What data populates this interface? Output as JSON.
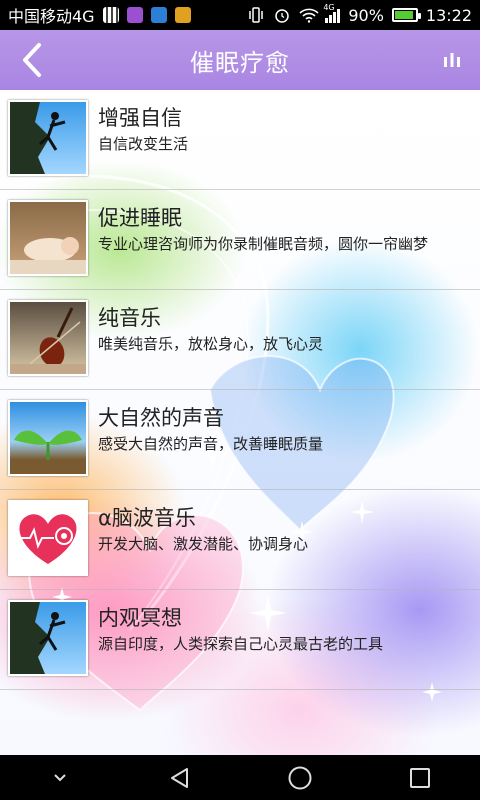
{
  "status_bar": {
    "carrier": "中国移动4G",
    "network_type": "4G",
    "battery_percent": "90%",
    "battery_level": 0.9,
    "time": "13:22",
    "notification_icons": [
      "qr-app-icon",
      "purple-app-icon",
      "blue-app-icon",
      "orange-app-icon"
    ]
  },
  "header": {
    "title": "催眠疗愈",
    "back_icon": "chevron-left-icon",
    "menu_icon": "bars-chart-icon"
  },
  "items": [
    {
      "title": "增强自信",
      "desc": "自信改变生活",
      "thumb": "climber"
    },
    {
      "title": "促进睡眠",
      "desc": "专业心理咨询师为你录制催眠音频，圆你一帘幽梦",
      "thumb": "baby"
    },
    {
      "title": "纯音乐",
      "desc": "唯美纯音乐，放松身心，放飞心灵",
      "thumb": "violin"
    },
    {
      "title": "大自然的声音",
      "desc": "感受大自然的声音，改善睡眠质量",
      "thumb": "sprout"
    },
    {
      "title": "α脑波音乐",
      "desc": "开发大脑、激发潜能、协调身心",
      "thumb": "brainwave"
    },
    {
      "title": "内观冥想",
      "desc": "源自印度，人类探索自己心灵最古老的工具",
      "thumb": "climber"
    }
  ],
  "nav_bar": {
    "buttons": [
      "hide-keyboard-icon",
      "back-triangle-icon",
      "home-circle-icon",
      "recents-square-icon"
    ]
  },
  "colors": {
    "header": "#a985e2",
    "status_bar": "#000000",
    "battery": "#55cc33"
  }
}
